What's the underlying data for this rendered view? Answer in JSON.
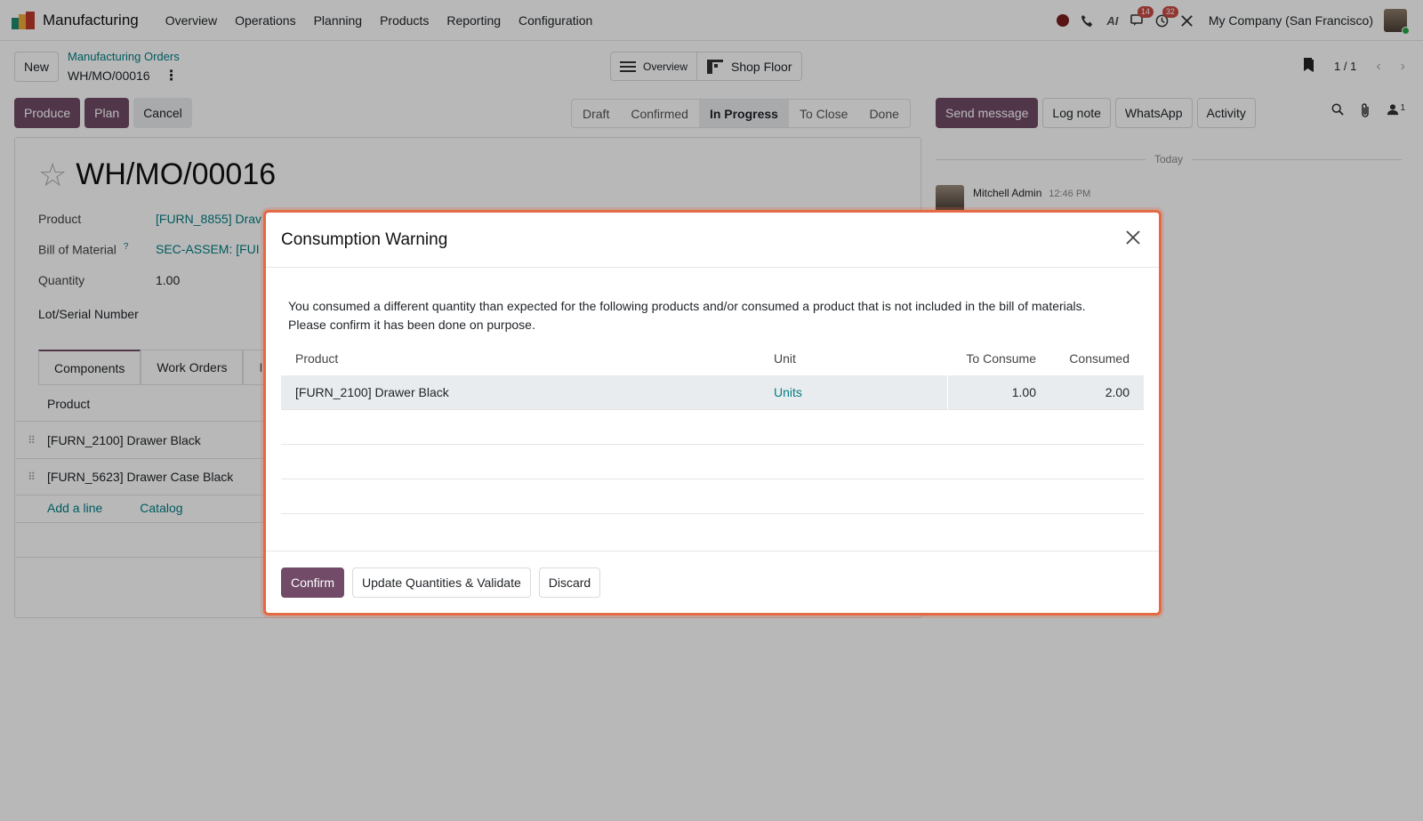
{
  "navbar": {
    "app_name": "Manufacturing",
    "menu": [
      "Overview",
      "Operations",
      "Planning",
      "Products",
      "Reporting",
      "Configuration"
    ],
    "messages_badge": "14",
    "activities_badge": "32",
    "ai_label": "AI",
    "company": "My Company (San Francisco)"
  },
  "control": {
    "new_label": "New",
    "breadcrumb": "Manufacturing Orders",
    "record": "WH/MO/00016",
    "overview_label": "Overview",
    "shop_floor_label": "Shop Floor",
    "pager": "1 / 1"
  },
  "actions": {
    "produce": "Produce",
    "plan": "Plan",
    "cancel": "Cancel"
  },
  "statusbar": {
    "stages": [
      "Draft",
      "Confirmed",
      "In Progress",
      "To Close",
      "Done"
    ],
    "active": "In Progress"
  },
  "chatter": {
    "send_message": "Send message",
    "log_note": "Log note",
    "whatsapp": "WhatsApp",
    "activity": "Activity",
    "followers_count": "1",
    "today": "Today",
    "author": "Mitchell Admin",
    "time": "12:46 PM"
  },
  "form": {
    "title": "WH/MO/00016",
    "product_label": "Product",
    "product_value": "[FURN_8855] Drav",
    "bom_label": "Bill of Material",
    "bom_help": "?",
    "bom_value": "SEC-ASSEM: [FUI",
    "quantity_label": "Quantity",
    "quantity_value": "1.00",
    "lot_label": "Lot/Serial Number",
    "tabs": [
      "Components",
      "Work Orders",
      "I"
    ],
    "components_header": "Product",
    "components": [
      "[FURN_2100] Drawer Black",
      "[FURN_5623] Drawer Case Black"
    ],
    "add_line": "Add a line",
    "catalog": "Catalog"
  },
  "modal": {
    "title": "Consumption Warning",
    "message_line1": "You consumed a different quantity than expected for the following products and/or consumed a product that is not included in the bill of materials.",
    "message_line2": "Please confirm it has been done on purpose.",
    "columns": {
      "product": "Product",
      "unit": "Unit",
      "to_consume": "To Consume",
      "consumed": "Consumed"
    },
    "rows": [
      {
        "product": "[FURN_2100] Drawer Black",
        "unit": "Units",
        "to_consume": "1.00",
        "consumed": "2.00"
      }
    ],
    "confirm": "Confirm",
    "update_validate": "Update Quantities & Validate",
    "discard": "Discard"
  },
  "colors": {
    "primary": "#714b67",
    "link": "#017e84",
    "highlight_border": "#e46a45"
  }
}
